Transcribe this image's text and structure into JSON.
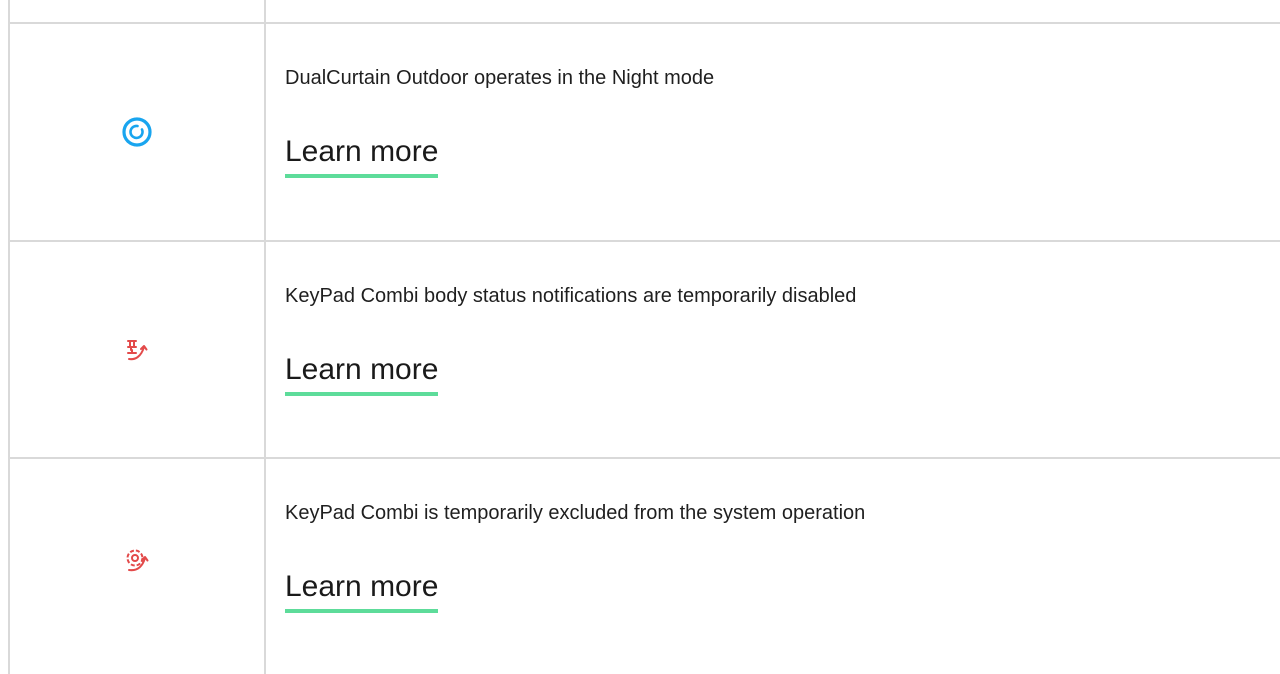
{
  "colors": {
    "border": "#d9d9d9",
    "link_underline": "#5ddc9a",
    "night_icon": "#19a5ef",
    "alert_icon": "#e34a4a"
  },
  "rows": [
    {
      "icon": "night-mode-icon",
      "description": "DualCurtain Outdoor operates in the Night mode",
      "link": "Learn more"
    },
    {
      "icon": "body-notifications-disabled-icon",
      "description": "KeyPad Combi body status notifications are temporarily disabled",
      "link": "Learn more"
    },
    {
      "icon": "device-excluded-icon",
      "description": "KeyPad Combi is temporarily excluded from the system operation",
      "link": "Learn more"
    }
  ]
}
